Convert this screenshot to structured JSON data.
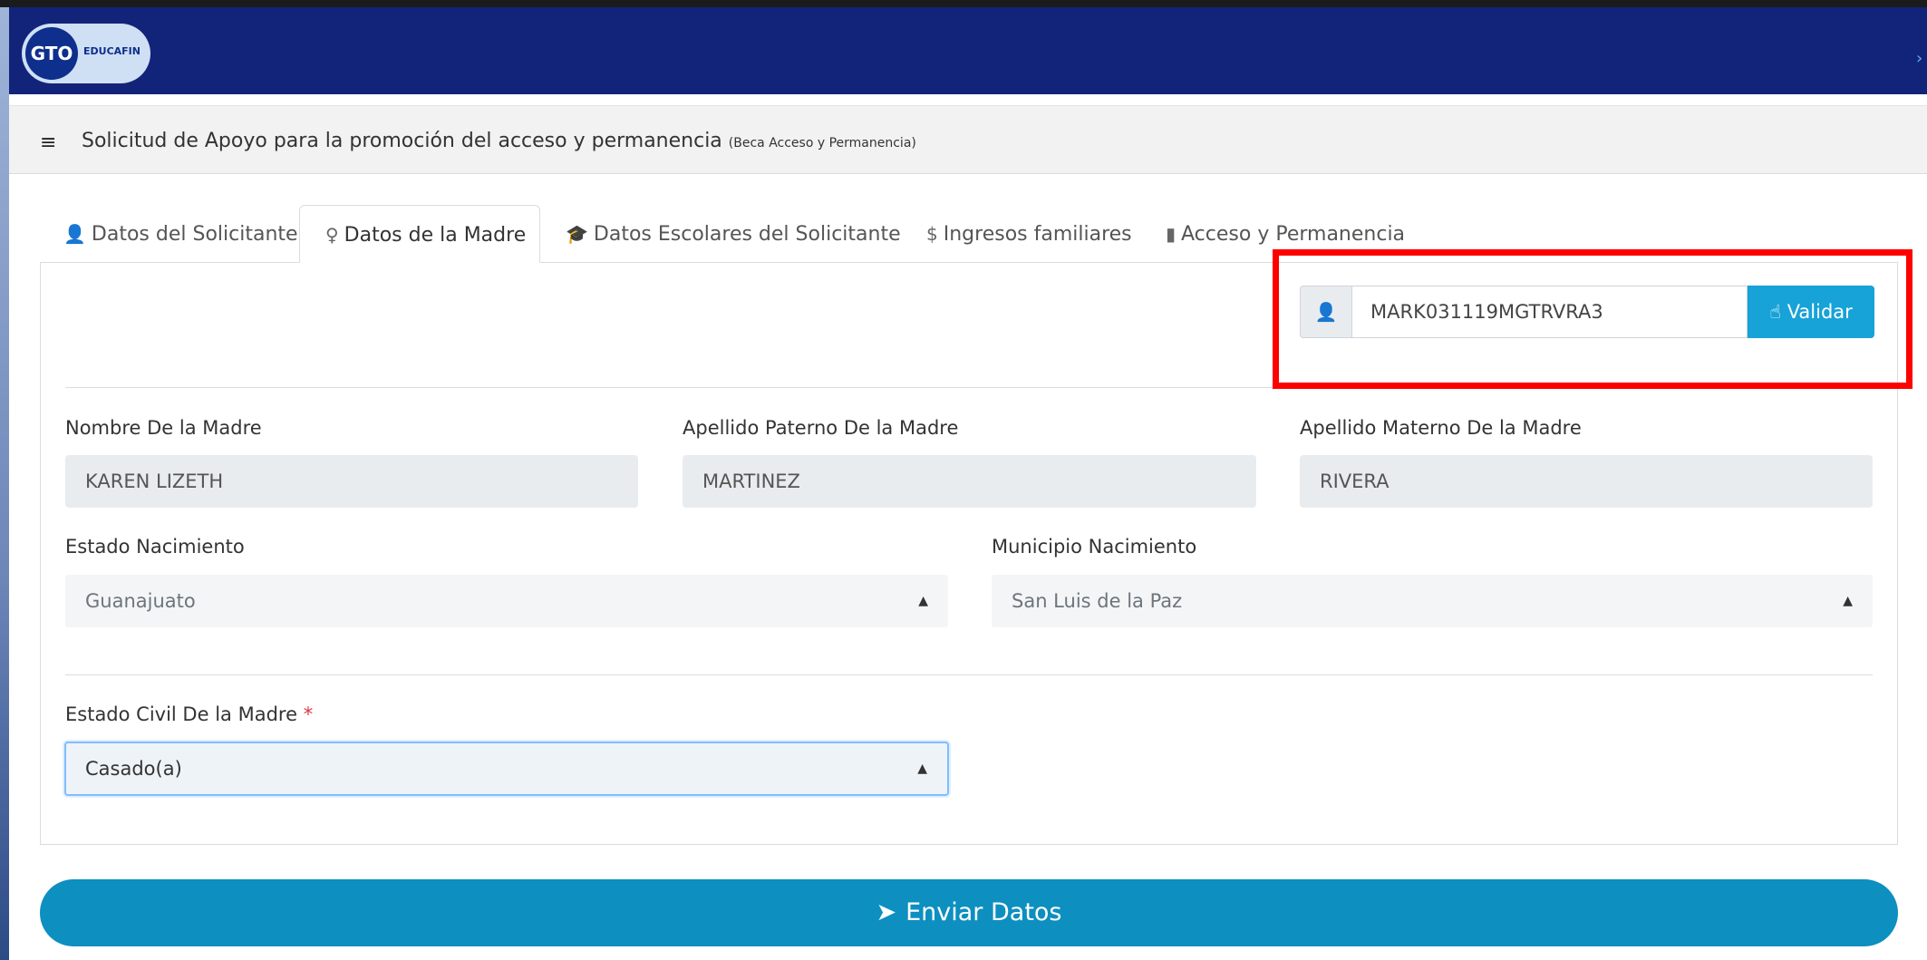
{
  "header": {
    "logo_main": "GTO",
    "logo_sub": "EDUCAFIN",
    "right_icon": "chevron-icon"
  },
  "page": {
    "title": "Solicitud de Apoyo para la promoción del acceso y permanencia",
    "title_small": "(Beca Acceso y Permanencia)"
  },
  "tabs": [
    {
      "label": "Datos del Solicitante",
      "icon": "user-icon"
    },
    {
      "label": "Datos de la Madre",
      "icon": "female-icon",
      "active": true
    },
    {
      "label": "Datos Escolares del Solicitante",
      "icon": "graduation-cap-icon"
    },
    {
      "label": "Ingresos familiares",
      "icon": "dollar-icon"
    },
    {
      "label": "Acceso y Permanencia",
      "icon": "file-icon"
    }
  ],
  "curp": {
    "value": "MARK031119MGTRVRA3",
    "button_label": "Validar"
  },
  "fields": {
    "nombre": {
      "label": "Nombre De la Madre",
      "value": "KAREN LIZETH"
    },
    "paterno": {
      "label": "Apellido Paterno De la Madre",
      "value": "MARTINEZ"
    },
    "materno": {
      "label": "Apellido Materno De la Madre",
      "value": "RIVERA"
    },
    "estado_nac": {
      "label": "Estado Nacimiento",
      "value": "Guanajuato"
    },
    "municipio_nac": {
      "label": "Municipio Nacimiento",
      "value": "San Luis de la Paz"
    },
    "estado_civil": {
      "label": "Estado Civil De la Madre",
      "required": "*",
      "value": "Casado(a)"
    }
  },
  "submit_label": "Enviar Datos",
  "colors": {
    "navbar": "#12247a",
    "accent": "#17a2d8",
    "submit": "#0d8fc0",
    "highlight": "#ff0000"
  }
}
